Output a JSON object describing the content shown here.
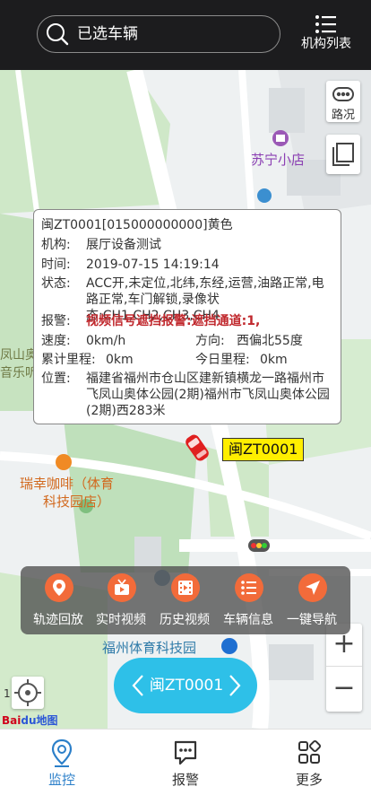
{
  "header": {
    "search_text": "已选车辆",
    "org_list_label": "机构列表"
  },
  "map": {
    "pois": {
      "suning": "苏宁小店",
      "cafe_line1": "瑞幸咖啡（体育",
      "cafe_line2": "科技园店）",
      "park": "福州体育科技园",
      "left_line1": "凤山奥",
      "left_line2": "音乐听"
    },
    "traffic_label": "路况",
    "zoom_in": "+",
    "zoom_out": "−",
    "scale_text": "1",
    "logo_bai": "Bai",
    "logo_du": "du地图"
  },
  "vehicle_popup": {
    "title": "闽ZT0001[015000000000]黄色",
    "org_key": "机构:",
    "org_value": "展厅设备测试",
    "time_key": "时间:",
    "time_value": "2019-07-15 14:19:14",
    "status_key": "状态:",
    "status_value": "ACC开,未定位,北纬,东经,运营,油路正常,电路正常,车门解锁,录像状态:CH1,CH2,CH3,CH4",
    "alarm_key": "报警:",
    "alarm_value": "视频信号遮挡报警:遮挡通道:1,",
    "speed_key": "速度:",
    "speed_value": "0km/h",
    "direction_key": "方向:",
    "direction_value": "西偏北55度",
    "total_mileage_key": "累计里程:",
    "total_mileage_value": "0km",
    "today_mileage_key": "今日里程:",
    "today_mileage_value": "0km",
    "location_key": "位置:",
    "location_value": "福建省福州市仓山区建新镇横龙一路福州市飞凤山奥体公园(2期)福州市飞凤山奥体公园(2期)西283米"
  },
  "vehicle_tag": "闽ZT0001",
  "actions": [
    {
      "label": "轨迹回放",
      "icon": "location-pin-icon"
    },
    {
      "label": "实时视频",
      "icon": "tv-icon"
    },
    {
      "label": "历史视频",
      "icon": "film-icon"
    },
    {
      "label": "车辆信息",
      "icon": "list-icon"
    },
    {
      "label": "一键导航",
      "icon": "navigation-arrow-icon"
    }
  ],
  "switcher": {
    "vehicle_name": "闽ZT0001"
  },
  "tabs": [
    {
      "label": "监控",
      "icon": "location-pin-icon",
      "active": true
    },
    {
      "label": "报警",
      "icon": "message-icon",
      "active": false
    },
    {
      "label": "更多",
      "icon": "grid-icon",
      "active": false
    }
  ],
  "colors": {
    "header_bg": "#1c1c1e",
    "accent_orange": "#f26b3a",
    "switcher_blue": "#2ec0e8",
    "tab_active": "#2b7fc9",
    "alarm_red": "#c0282d",
    "plate_yellow": "#ffee00"
  }
}
